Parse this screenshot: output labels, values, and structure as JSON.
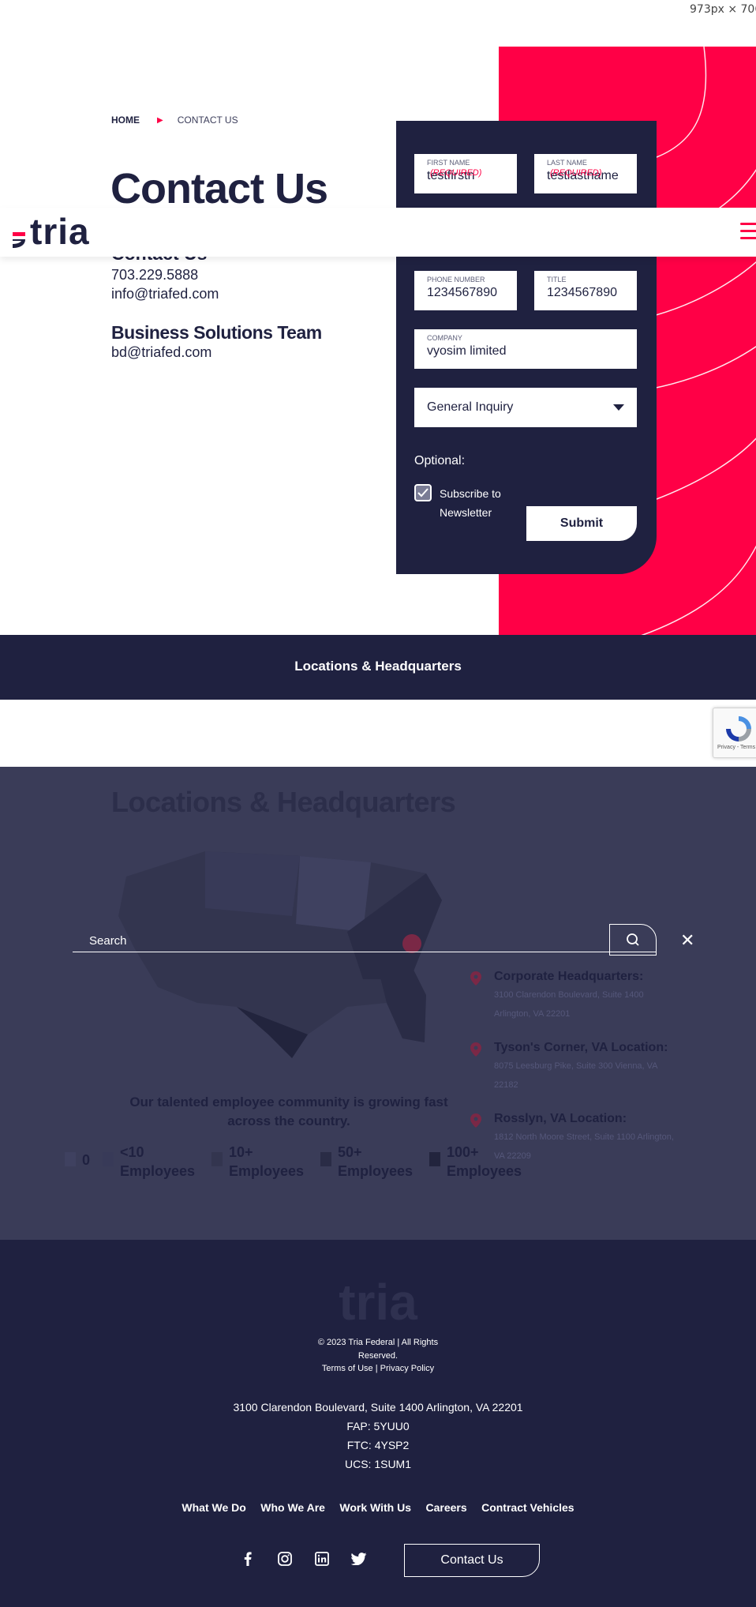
{
  "overlay_text": {
    "dimensions": "973px × 706px"
  },
  "breadcrumb": {
    "home": "HOME",
    "current": "CONTACT US"
  },
  "page_title": "Contact Us",
  "navbar": {
    "logo_text": "tria"
  },
  "contact": {
    "heading": "Contact Us",
    "phone": "703.229.5888",
    "email": "info@triafed.com",
    "bst_heading": "Business Solutions Team",
    "bst_email": "bd@triafed.com"
  },
  "form": {
    "first_name": {
      "label": "FIRST NAME",
      "required": "(REQUIRED)",
      "value": "testfirstn"
    },
    "last_name": {
      "label": "LAST NAME",
      "required": "(REQUIRED)",
      "value": "testlastname"
    },
    "phone": {
      "label": "PHONE NUMBER",
      "value": "1234567890"
    },
    "title": {
      "label": "TITLE",
      "value": "1234567890"
    },
    "company": {
      "label": "COMPANY",
      "value": "vyosim limited"
    },
    "inquiry_selected": "General Inquiry",
    "optional": "Optional:",
    "subscribe_label": "Subscribe to Newsletter",
    "subscribe_checked": true,
    "submit": "Submit"
  },
  "locations_band": "Locations & Headquarters",
  "recaptcha": {
    "links": "Privacy - Terms"
  },
  "locations": {
    "title": "Locations & Headquarters",
    "search_placeholder": "Search",
    "items": [
      {
        "name": "Corporate Headquarters:",
        "address": "3100 Clarendon Boulevard, Suite 1400 Arlington, VA 22201"
      },
      {
        "name": "Tyson's Corner, VA Location:",
        "address": "8075 Leesburg Pike, Suite 300 Vienna, VA 22182"
      },
      {
        "name": "Rosslyn, VA Location:",
        "address": "1812 North Moore Street, Suite 1100 Arlington, VA 22209"
      }
    ],
    "growing": "Our talented employee community is growing fast across the country.",
    "legend": [
      "0",
      "<10 Employees",
      "10+ Employees",
      "50+ Employees",
      "100+ Employees"
    ],
    "legend_colors": [
      "#3f4160",
      "#383a58",
      "#33354f",
      "#2a2c46",
      "#22243d"
    ]
  },
  "footer": {
    "logo_text": "tria",
    "copyright_1": "© 2023 Tria Federal | All Rights",
    "copyright_2": "Reserved.",
    "terms": "Terms of Use",
    "sep": "|",
    "privacy": "Privacy Policy",
    "address": "3100 Clarendon Boulevard, Suite 1400 Arlington, VA 22201",
    "fap": "FAP: 5YUU0",
    "ftc": "FTC: 4YSP2",
    "ucs": "UCS: 1SUM1",
    "nav": [
      "What We Do",
      "Who We Are",
      "Work With Us",
      "Careers",
      "Contract Vehicles"
    ],
    "social_icons": [
      "facebook-icon",
      "instagram-icon",
      "linkedin-icon",
      "twitter-icon"
    ],
    "contact_button": "Contact Us"
  },
  "colors": {
    "accent": "#ff0046",
    "navy": "#1f2140",
    "overlay": "#3a3c58"
  }
}
